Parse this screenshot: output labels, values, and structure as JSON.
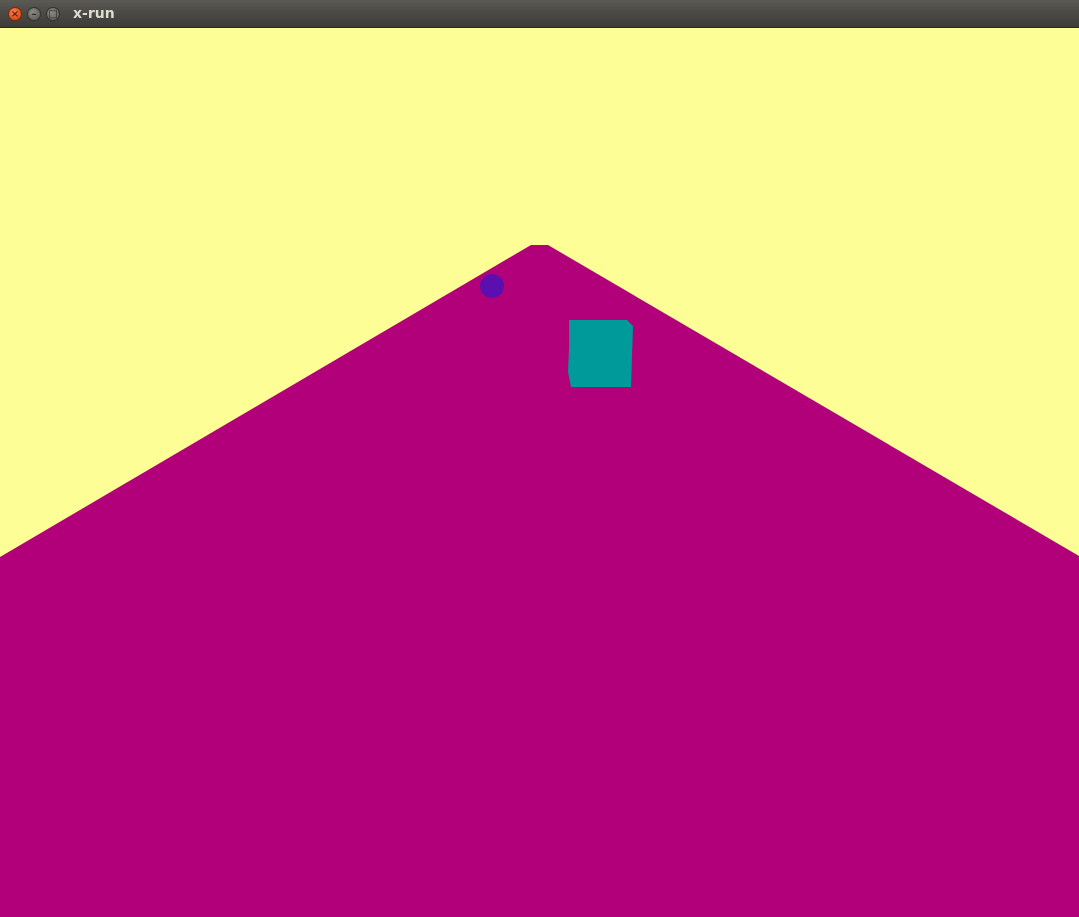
{
  "window": {
    "title": "x-run",
    "close_symbol": "×",
    "minimize_symbol": "–",
    "maximize_symbol": "□"
  },
  "scene": {
    "sky_color": "#fdff96",
    "ground_color": "#b1007a",
    "player_color": "#009a9a",
    "orb_color": "#5a0fae"
  }
}
